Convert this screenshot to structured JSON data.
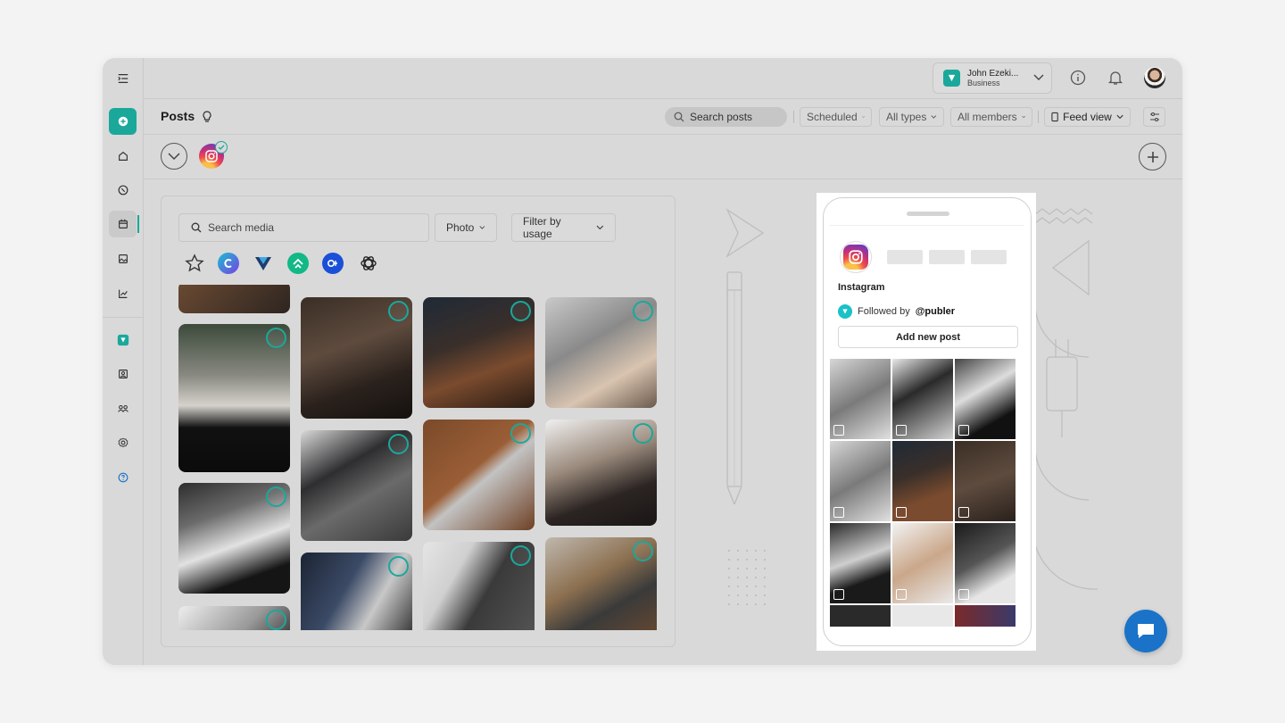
{
  "account": {
    "name": "John Ezeki...",
    "type": "Business"
  },
  "page": {
    "title": "Posts"
  },
  "toolbar": {
    "search_placeholder": "Search posts",
    "status_filter": "Scheduled",
    "type_filter": "All types",
    "member_filter": "All members",
    "view_mode": "Feed view"
  },
  "media": {
    "search_placeholder": "Search media",
    "type_filter": "Photo",
    "usage_filter": "Filter by usage",
    "sources": [
      "star-icon",
      "canva-icon",
      "vista-icon",
      "unsplash-icon",
      "dropbox-icon",
      "openai-icon"
    ]
  },
  "preview": {
    "profile_name": "Instagram",
    "followed_prefix": "Followed by",
    "followed_handle": "@publer",
    "add_post_label": "Add new post"
  },
  "colors": {
    "accent": "#1aa89b",
    "chat": "#1a73c8",
    "background": "#d9d9d9"
  }
}
